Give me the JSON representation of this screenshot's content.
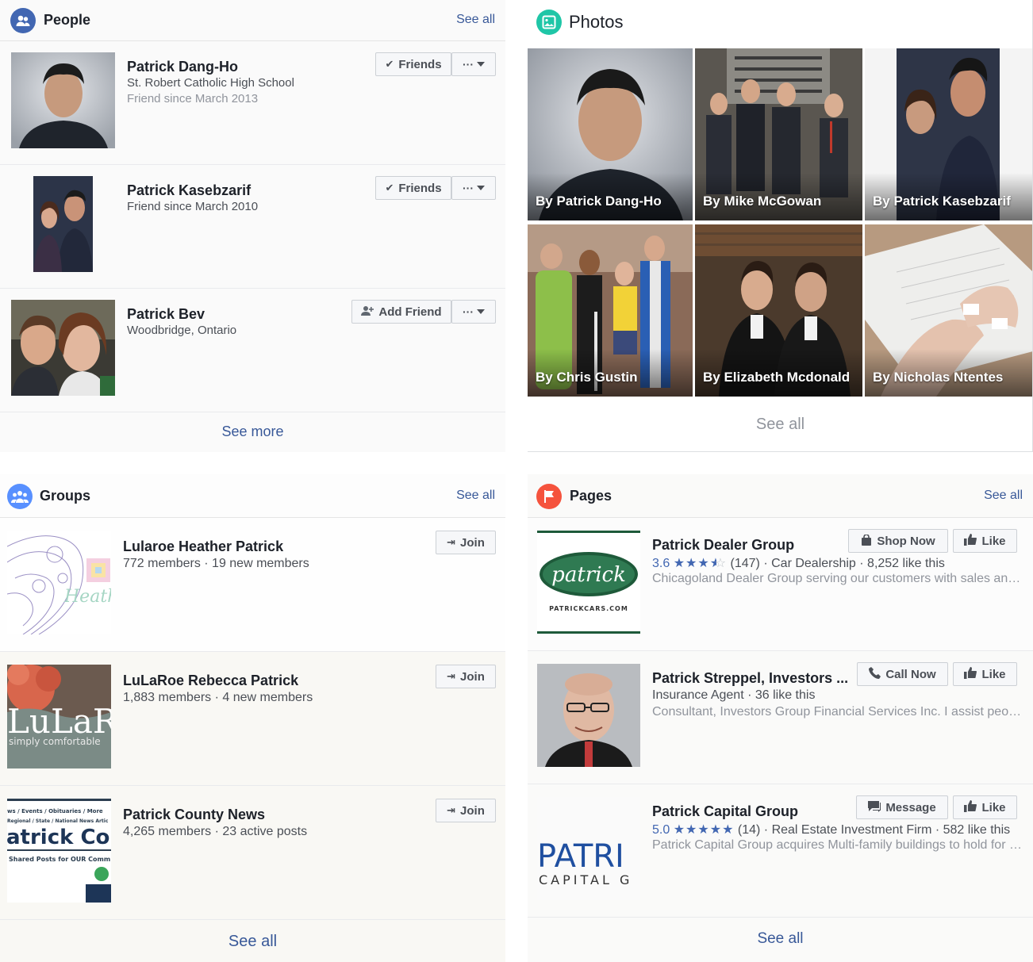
{
  "people": {
    "title": "People",
    "see_all": "See all",
    "items": [
      {
        "name": "Patrick Dang-Ho",
        "line1": "St. Robert Catholic High School",
        "line2": "Friend since March 2013",
        "action": "Friends",
        "more": "···"
      },
      {
        "name": "Patrick Kasebzarif",
        "line1": "Friend since March 2010",
        "line2": "",
        "action": "Friends",
        "more": "···"
      },
      {
        "name": "Patrick Bev",
        "line1": "Woodbridge, Ontario",
        "line2": "",
        "action": "Add Friend",
        "more": "···"
      }
    ],
    "see_more": "See more"
  },
  "photos": {
    "title": "Photos",
    "items": [
      {
        "caption": "By Patrick Dang-Ho"
      },
      {
        "caption": "By Mike McGowan"
      },
      {
        "caption": "By Patrick Kasebzarif"
      },
      {
        "caption": "By Chris Gustin"
      },
      {
        "caption": "By Elizabeth Mcdonald"
      },
      {
        "caption": "By Nicholas Ntentes"
      }
    ],
    "see_all": "See all"
  },
  "groups": {
    "title": "Groups",
    "see_all": "See all",
    "items": [
      {
        "name": "Lularoe Heather Patrick",
        "meta": "772 members · 19 new members",
        "action": "Join",
        "thumb_text": "Heath"
      },
      {
        "name": "LuLaRoe Rebecca Patrick",
        "meta": "1,883 members · 4 new members",
        "action": "Join",
        "thumb_text": "LuLaRo",
        "thumb_sub": "simply comfortable"
      },
      {
        "name": "Patrick County News",
        "meta": "4,265 members · 23 active posts",
        "action": "Join",
        "thumb_text": "atrick Cou",
        "thumb_top": "ws / Events / Obituaries / More",
        "thumb_top2": "Regional / State / National  News Artic",
        "thumb_sub": "Shared Posts for OUR Comm"
      }
    ],
    "bottom_see_all": "See all"
  },
  "pages": {
    "title": "Pages",
    "see_all": "See all",
    "items": [
      {
        "name": "Patrick Dealer Group",
        "rating": "3.6",
        "reviews": "(147) ·",
        "category": "Car Dealership · 8,252 like this",
        "desc": "Chicagoland Dealer Group serving our customers with sales and ...",
        "action": "Shop Now",
        "like": "Like",
        "logo_text": "patrick",
        "logo_sub": "PATRICKCARS.COM"
      },
      {
        "name": "Patrick Streppel, Investors ...",
        "rating": "",
        "reviews": "",
        "category": "Insurance Agent · 36 like this",
        "desc": "Consultant, Investors Group Financial Services Inc. I assist peopl...",
        "action": "Call Now",
        "like": "Like"
      },
      {
        "name": "Patrick Capital Group",
        "rating": "5.0",
        "reviews": "(14) ·",
        "category": "Real Estate Investment Firm · 582 like this",
        "desc": "Patrick Capital Group acquires Multi-family buildings to hold for th...",
        "action": "Message",
        "like": "Like",
        "logo_text": "PATRI",
        "logo_sub": "CAPITAL G"
      }
    ],
    "bottom_see_all": "See all"
  },
  "colors": {
    "link": "#385898",
    "people_icon": "#4267b2",
    "photos_icon": "#1fc6a7",
    "groups_icon": "#5890ff",
    "pages_icon": "#f5533d",
    "rating": "#4267b2"
  }
}
